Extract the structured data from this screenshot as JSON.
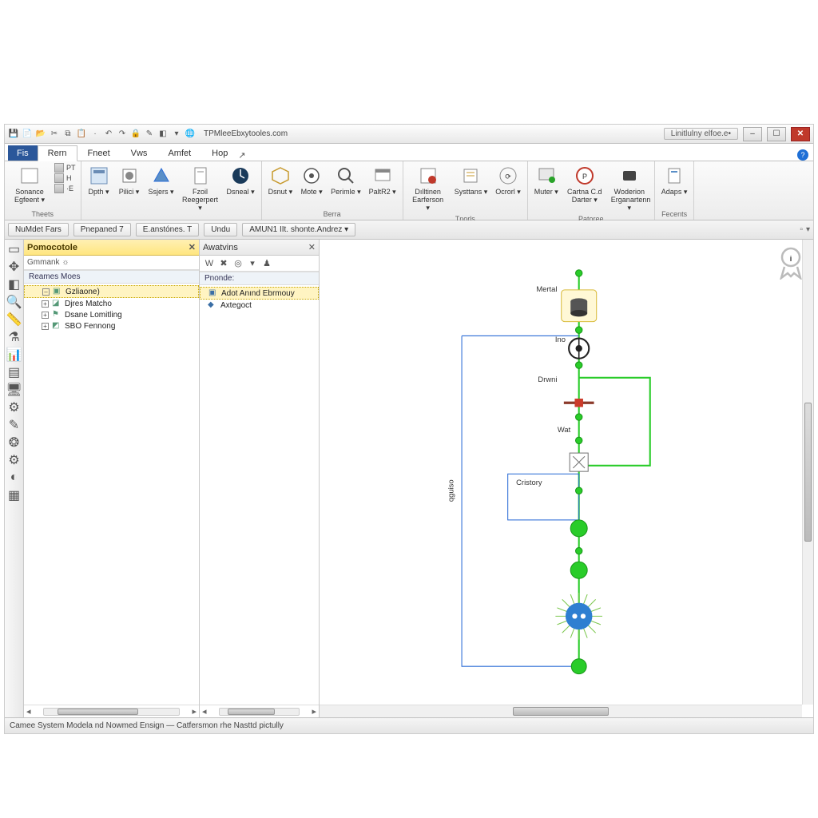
{
  "titlebar": {
    "title": "TPMleeEbxytooles.com",
    "right_pill": "Linitlulny elfoe.e•",
    "min": "–",
    "max": "☐",
    "close": "✕"
  },
  "menu": {
    "file": "Fis",
    "tabs": [
      "Rern",
      "Fneet",
      "Vws",
      "Amfet",
      "Hop"
    ]
  },
  "ribbon": {
    "groups": [
      {
        "label": "Theets",
        "items": [
          {
            "label": "Sonance Egfeent"
          },
          {
            "stack": [
              "PT",
              "H",
              "·E"
            ]
          }
        ]
      },
      {
        "label": "",
        "items": [
          {
            "label": "Dpth"
          },
          {
            "label": "Pilici"
          },
          {
            "label": "Ssjers"
          },
          {
            "label": "Fzoil Reegerpert"
          },
          {
            "label": "Dsneal"
          }
        ]
      },
      {
        "label": "Berra",
        "items": [
          {
            "label": "Dsnut"
          },
          {
            "label": "Mote"
          },
          {
            "label": "Perimle"
          },
          {
            "label": "PaltR2"
          }
        ]
      },
      {
        "label": "Tnorls",
        "items": [
          {
            "label": "Dılltinen Earferson"
          },
          {
            "label": "Systtans"
          },
          {
            "label": "Ocrorl"
          }
        ]
      },
      {
        "label": "Patoree",
        "items": [
          {
            "label": "Muter"
          },
          {
            "label": "Cartna C.d Darter"
          },
          {
            "label": "Woderion Erganartenn"
          }
        ]
      },
      {
        "label": "Fecents",
        "items": [
          {
            "label": "Adaps"
          }
        ]
      }
    ]
  },
  "subtoolbar": {
    "buttons": [
      "NuMdet Fars",
      "Pnepaned 7",
      "E.anstónes. T",
      "Undu",
      "AMUN1 IIt. shonte.Andrez ▾"
    ]
  },
  "vtoolbar_tips": [
    "select",
    "pan",
    "containment",
    "search",
    "measure",
    "flask",
    "chart",
    "layers",
    "monitor",
    "settings",
    "pen",
    "gear-color",
    "cog",
    "toggle",
    "present"
  ],
  "panels": {
    "project": {
      "title": "Pomocotole",
      "sub": "Gmmank  ☼",
      "section": "Reames Moes",
      "items": [
        {
          "label": "Gzliaone)",
          "selected": true
        },
        {
          "label": "Djres Matcho"
        },
        {
          "label": "Dsane Lomitling"
        },
        {
          "label": "SBO Fennong"
        }
      ]
    },
    "activity": {
      "title": "Awatvins",
      "section": "Pnonde:",
      "items": [
        {
          "label": "Adot Anınd Ebrmouy",
          "selected": true
        },
        {
          "label": "Axtegoct"
        }
      ]
    }
  },
  "diagram": {
    "labels": {
      "material": "Mertal",
      "im": "Ino",
      "drwni": "Drwni",
      "axis": "qguiso",
      "cistorv": "Cristory",
      "mid": "Wat"
    }
  },
  "status": "Camee System Modela nd Nowmed Ensign — Catfersmon rhe Nasttd pictully"
}
